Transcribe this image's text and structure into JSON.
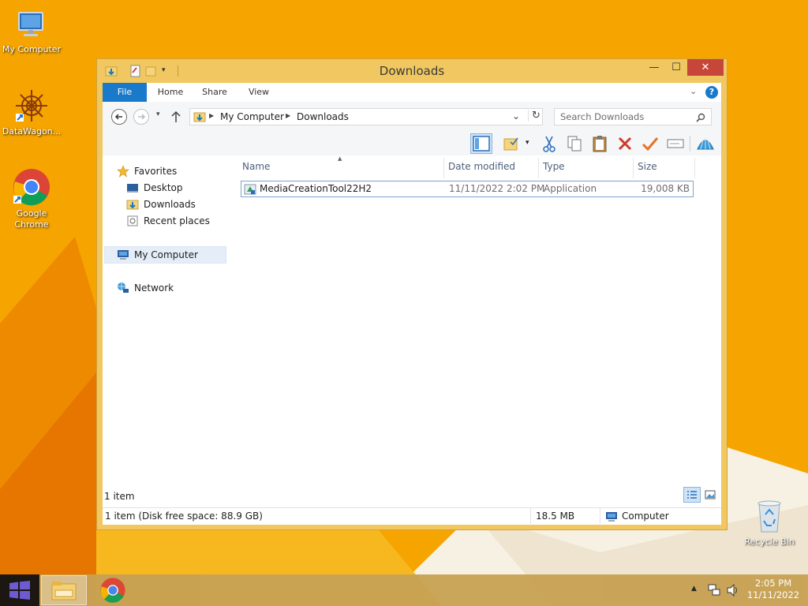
{
  "desktop": {
    "icons": [
      {
        "label": "My Computer"
      },
      {
        "label": "DataWagon..."
      },
      {
        "label": "Google Chrome"
      },
      {
        "label": "Recycle Bin"
      }
    ]
  },
  "window": {
    "title": "Downloads",
    "minimize_glyph": "—",
    "maximize_glyph": "☐",
    "close_glyph": "✕"
  },
  "ribbon": {
    "tabs": [
      "File",
      "Home",
      "Share",
      "View"
    ],
    "help_glyph": "?"
  },
  "address": {
    "path": [
      "My Computer",
      "Downloads"
    ],
    "search_placeholder": "Search Downloads"
  },
  "columns": [
    "Name",
    "Date modified",
    "Type",
    "Size"
  ],
  "files": [
    {
      "name": "MediaCreationTool22H2",
      "date": "11/11/2022 2:02 PM",
      "type": "Application",
      "size": "19,008 KB"
    }
  ],
  "navpane": {
    "favorites": "Favorites",
    "items": [
      "Desktop",
      "Downloads",
      "Recent places"
    ],
    "computer": "My Computer",
    "network": "Network"
  },
  "status": {
    "count": "1 item",
    "detail": "1 item (Disk free space: 88.9 GB)",
    "size": "18.5 MB",
    "computer": "Computer"
  },
  "taskbar": {
    "time": "2:05 PM",
    "date": "11/11/2022"
  },
  "colors": {
    "accent": "#1979ca",
    "desktop_bg": "#f5a800",
    "close_button": "#c7463a"
  }
}
